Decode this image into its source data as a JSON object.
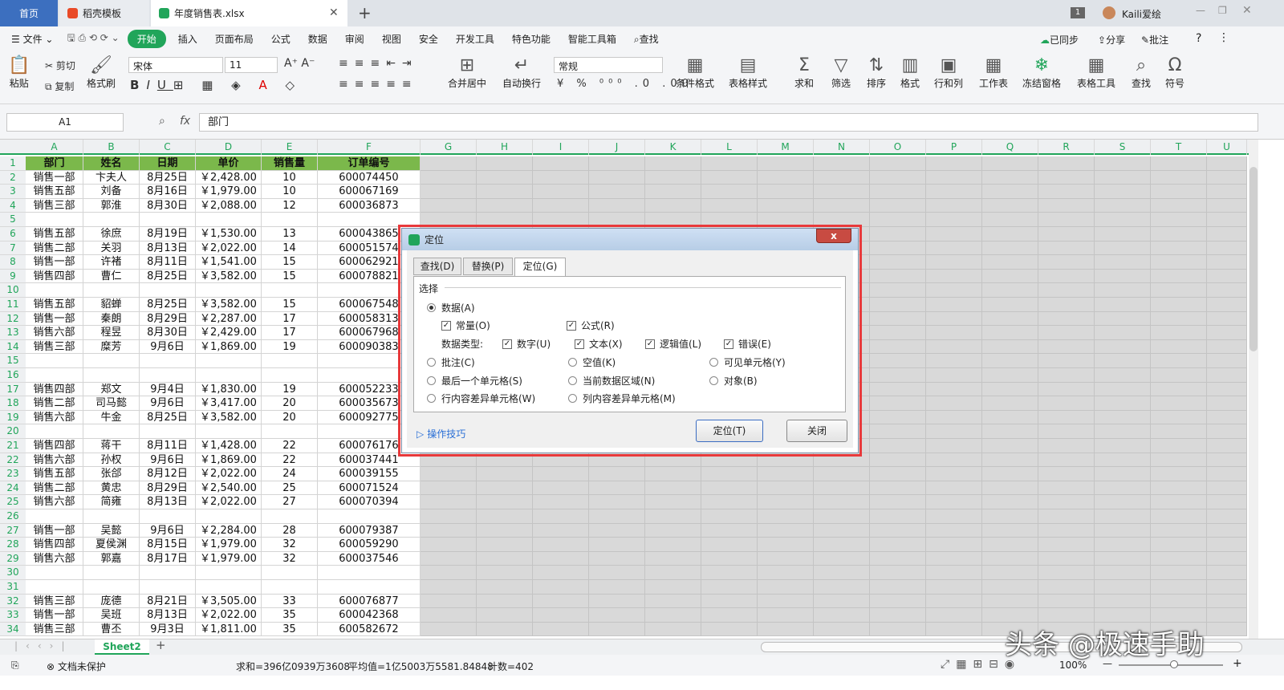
{
  "tabs": {
    "home": "首页",
    "template": "稻壳模板",
    "file": "年度销售表.xlsx",
    "add": "+"
  },
  "titlebar": {
    "badge": "1",
    "user": "Kaili爱绘"
  },
  "menu": {
    "file": "文件",
    "items": [
      "开始",
      "插入",
      "页面布局",
      "公式",
      "数据",
      "审阅",
      "视图",
      "安全",
      "开发工具",
      "特色功能",
      "智能工具箱"
    ],
    "search": "查找",
    "sync": "已同步",
    "share": "分享",
    "comment": "批注",
    "help": "?"
  },
  "ribbon": {
    "paste": "粘贴",
    "cut": "剪切",
    "copy": "复制",
    "format_painter": "格式刷",
    "font": "宋体",
    "size": "11",
    "merge": "合并居中",
    "wrap": "自动换行",
    "numfmt": "常规",
    "cond_format": "条件格式",
    "table_style": "表格样式",
    "sum": "求和",
    "filter": "筛选",
    "sort": "排序",
    "format": "格式",
    "rowcol": "行和列",
    "sheet": "工作表",
    "freeze": "冻结窗格",
    "table_tool": "表格工具",
    "find": "查找",
    "symbol": "符号"
  },
  "formula": {
    "namebox": "A1",
    "fx": "fx",
    "value": "部门"
  },
  "columns": [
    "A",
    "B",
    "C",
    "D",
    "E",
    "F",
    "G",
    "H",
    "I",
    "J",
    "K",
    "L",
    "M",
    "N",
    "O",
    "P",
    "Q",
    "R",
    "S",
    "T",
    "U"
  ],
  "headers": [
    "部门",
    "姓名",
    "日期",
    "单价",
    "销售量",
    "订单编号"
  ],
  "rows": [
    [
      "销售一部",
      "卞夫人",
      "8月25日",
      "￥2,428.00",
      "10",
      "600074450"
    ],
    [
      "销售五部",
      "刘备",
      "8月16日",
      "￥1,979.00",
      "10",
      "600067169"
    ],
    [
      "销售三部",
      "郭淮",
      "8月30日",
      "￥2,088.00",
      "12",
      "600036873"
    ],
    [
      "",
      "",
      "",
      "",
      "",
      ""
    ],
    [
      "销售五部",
      "徐庶",
      "8月19日",
      "￥1,530.00",
      "13",
      "600043865"
    ],
    [
      "销售二部",
      "关羽",
      "8月13日",
      "￥2,022.00",
      "14",
      "600051574"
    ],
    [
      "销售一部",
      "许褚",
      "8月11日",
      "￥1,541.00",
      "15",
      "600062921"
    ],
    [
      "销售四部",
      "曹仁",
      "8月25日",
      "￥3,582.00",
      "15",
      "600078821"
    ],
    [
      "",
      "",
      "",
      "",
      "",
      ""
    ],
    [
      "销售五部",
      "貂蝉",
      "8月25日",
      "￥3,582.00",
      "15",
      "600067548"
    ],
    [
      "销售一部",
      "秦朗",
      "8月29日",
      "￥2,287.00",
      "17",
      "600058313"
    ],
    [
      "销售六部",
      "程昱",
      "8月30日",
      "￥2,429.00",
      "17",
      "600067968"
    ],
    [
      "销售三部",
      "糜芳",
      "9月6日",
      "￥1,869.00",
      "19",
      "600090383"
    ],
    [
      "",
      "",
      "",
      "",
      "",
      ""
    ],
    [
      "",
      "",
      "",
      "",
      "",
      ""
    ],
    [
      "销售四部",
      "郑文",
      "9月4日",
      "￥1,830.00",
      "19",
      "600052233"
    ],
    [
      "销售二部",
      "司马懿",
      "9月6日",
      "￥3,417.00",
      "20",
      "600035673"
    ],
    [
      "销售六部",
      "牛金",
      "8月25日",
      "￥3,582.00",
      "20",
      "600092775"
    ],
    [
      "",
      "",
      "",
      "",
      "",
      ""
    ],
    [
      "销售四部",
      "蒋干",
      "8月11日",
      "￥1,428.00",
      "22",
      "600076176"
    ],
    [
      "销售六部",
      "孙权",
      "9月6日",
      "￥1,869.00",
      "22",
      "600037441"
    ],
    [
      "销售五部",
      "张郃",
      "8月12日",
      "￥2,022.00",
      "24",
      "600039155"
    ],
    [
      "销售二部",
      "黄忠",
      "8月29日",
      "￥2,540.00",
      "25",
      "600071524"
    ],
    [
      "销售六部",
      "简雍",
      "8月13日",
      "￥2,022.00",
      "27",
      "600070394"
    ],
    [
      "",
      "",
      "",
      "",
      "",
      ""
    ],
    [
      "销售一部",
      "吴懿",
      "9月6日",
      "￥2,284.00",
      "28",
      "600079387"
    ],
    [
      "销售四部",
      "夏侯渊",
      "8月15日",
      "￥1,979.00",
      "32",
      "600059290"
    ],
    [
      "销售六部",
      "郭嘉",
      "8月17日",
      "￥1,979.00",
      "32",
      "600037546"
    ],
    [
      "",
      "",
      "",
      "",
      "",
      ""
    ],
    [
      "",
      "",
      "",
      "",
      "",
      ""
    ],
    [
      "销售三部",
      "庞德",
      "8月21日",
      "￥3,505.00",
      "33",
      "600076877"
    ],
    [
      "销售一部",
      "吴班",
      "8月13日",
      "￥2,022.00",
      "35",
      "600042368"
    ],
    [
      "销售三部",
      "曹丕",
      "9月3日",
      "￥1,811.00",
      "35",
      "600582672"
    ]
  ],
  "sheet": {
    "name": "Sheet2",
    "add": "+"
  },
  "status": {
    "protect": "文档未保护",
    "sum": "求和=396亿0939万3608",
    "avg": "平均值=1亿5003万5581.84848",
    "count": "计数=402",
    "zoom": "100%"
  },
  "dialog": {
    "title": "定位",
    "close": "x",
    "tabs": [
      "查找(D)",
      "替换(P)",
      "定位(G)"
    ],
    "group": "选择",
    "data": "数据(A)",
    "const": "常量(O)",
    "formula": "公式(R)",
    "types_label": "数据类型:",
    "num": "数字(U)",
    "text": "文本(X)",
    "logic": "逻辑值(L)",
    "error": "错误(E)",
    "comment": "批注(C)",
    "blank": "空值(K)",
    "visible": "可见单元格(Y)",
    "lastcell": "最后一个单元格(S)",
    "region": "当前数据区域(N)",
    "object": "对象(B)",
    "rowdiff": "行内容差异单元格(W)",
    "coldiff": "列内容差异单元格(M)",
    "tips": "操作技巧",
    "ok": "定位(T)",
    "cancel": "关闭"
  },
  "watermark": "头条 @极速手助"
}
